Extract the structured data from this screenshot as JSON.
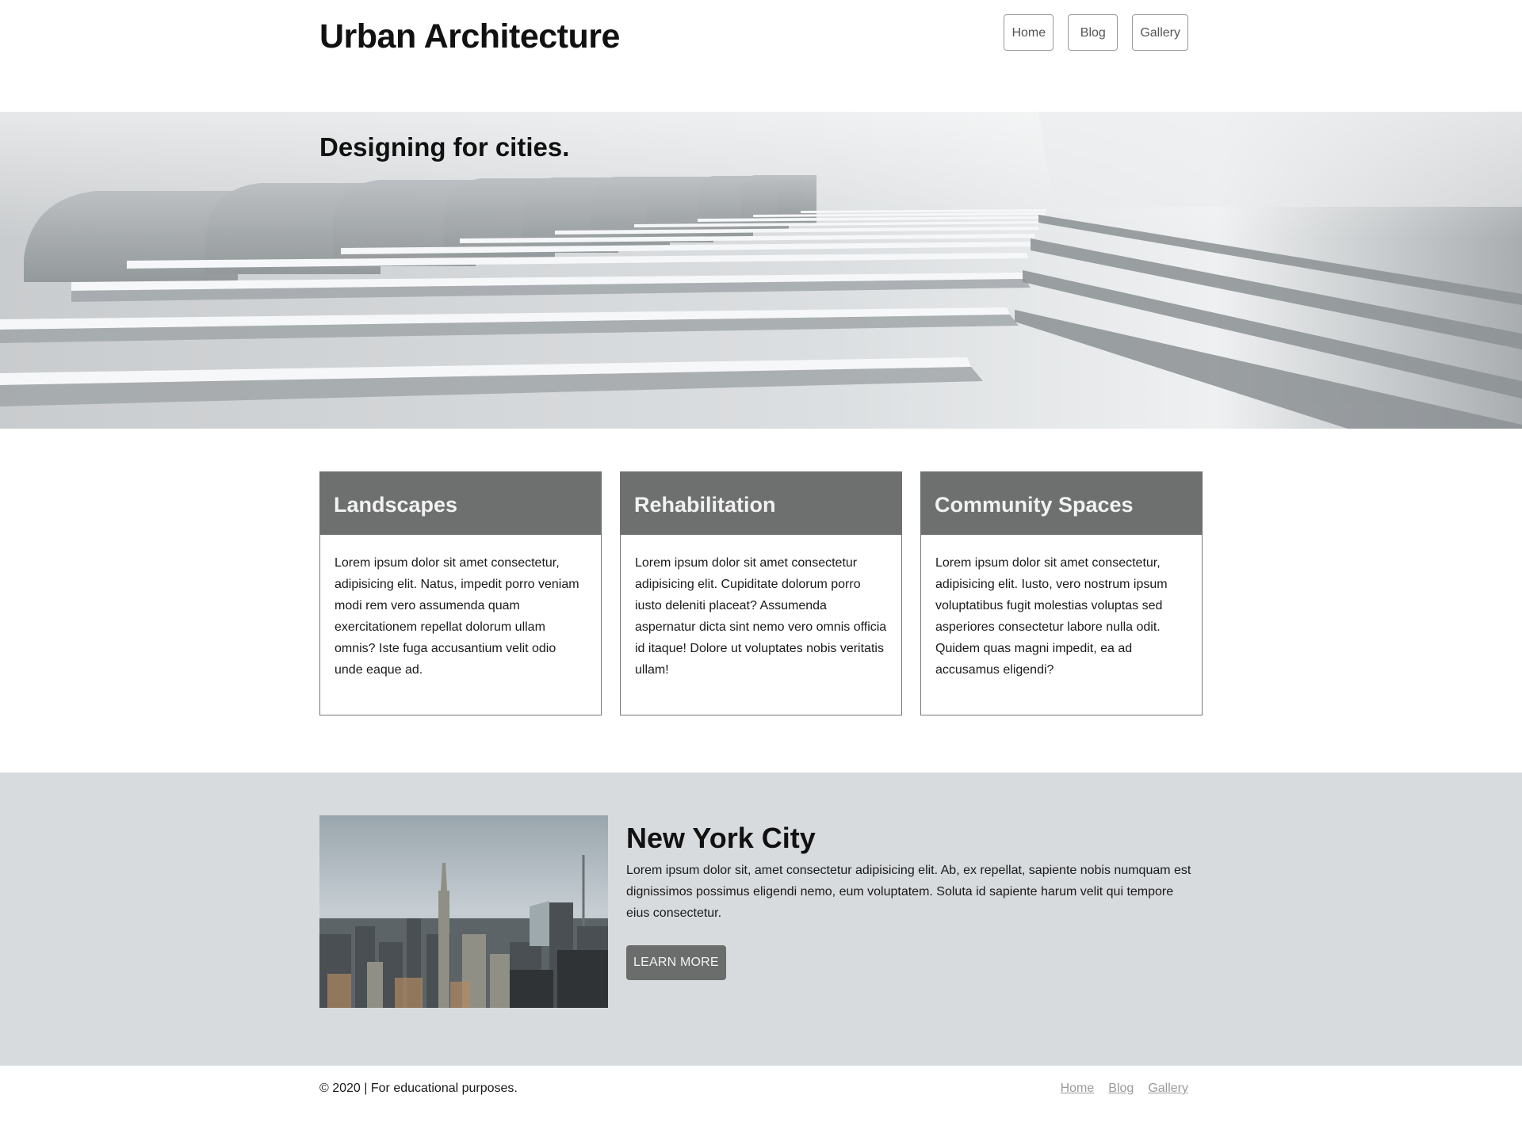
{
  "header": {
    "title": "Urban Architecture",
    "nav": [
      {
        "label": "Home"
      },
      {
        "label": "Blog"
      },
      {
        "label": "Gallery"
      }
    ]
  },
  "hero": {
    "heading": "Designing for cities."
  },
  "cards": [
    {
      "title": "Landscapes",
      "text": "Lorem ipsum dolor sit amet consectetur, adipisicing elit. Natus, impedit porro veniam modi rem vero assumenda quam exercitationem repellat dolorum ullam omnis? Iste fuga accusantium velit odio unde eaque ad."
    },
    {
      "title": "Rehabilitation",
      "text": "Lorem ipsum dolor sit amet consectetur adipisicing elit. Cupiditate dolorum porro iusto deleniti placeat? Assumenda aspernatur dicta sint nemo vero omnis officia id itaque! Dolore ut voluptates nobis veritatis ullam!"
    },
    {
      "title": "Community Spaces",
      "text": "Lorem ipsum dolor sit amet consectetur, adipisicing elit. Iusto, vero nostrum ipsum voluptatibus fugit molestias voluptas sed asperiores consectetur labore nulla odit. Quidem quas magni impedit, ea ad accusamus eligendi?"
    }
  ],
  "feature": {
    "title": "New York City",
    "text": "Lorem ipsum dolor sit, amet consectetur adipisicing elit. Ab, ex repellat, sapiente nobis numquam est dignissimos possimus eligendi nemo, eum voluptatem. Soluta id sapiente harum velit qui tempore eius consectetur.",
    "button_label": "LEARN MORE"
  },
  "footer": {
    "copyright": "© 2020 | For educational purposes.",
    "links": [
      {
        "label": "Home"
      },
      {
        "label": "Blog"
      },
      {
        "label": "Gallery"
      }
    ]
  },
  "colors": {
    "card_header": "#6e7070",
    "feature_bg": "#d8dbde",
    "button_bg": "#6b6d6d",
    "footer_link": "#9a9a9a"
  }
}
